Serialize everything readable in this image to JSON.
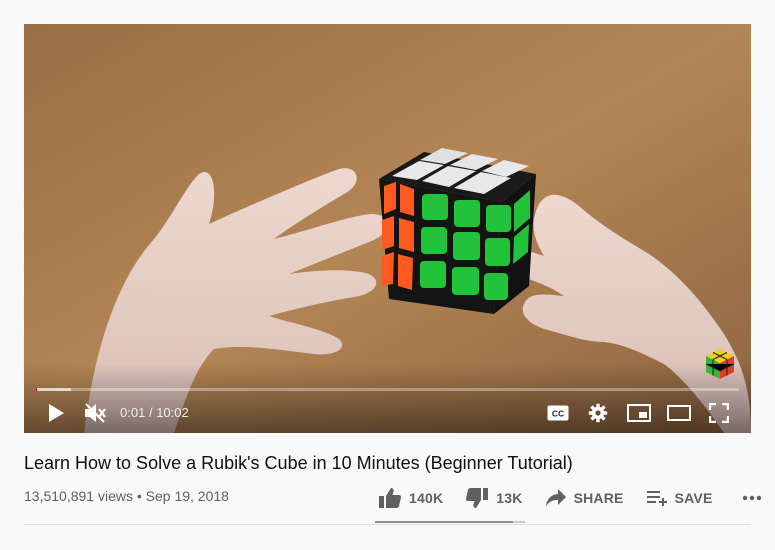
{
  "video": {
    "time_current": "0:01",
    "time_separator": "/",
    "time_total": "10:02",
    "progress_played_fraction": 0.002,
    "progress_loaded_fraction": 0.05
  },
  "controls": {
    "play_icon": "play-icon",
    "mute_icon": "volume-muted-icon",
    "cc_label": "CC",
    "settings_icon": "gear-icon",
    "miniplayer_icon": "miniplayer-icon",
    "theater_icon": "theater-mode-icon",
    "fullscreen_icon": "fullscreen-icon"
  },
  "info": {
    "title": "Learn How to Solve a Rubik's Cube in 10 Minutes (Beginner Tutorial)",
    "views": "13,510,891 views",
    "dot": "•",
    "date": "Sep 19, 2018"
  },
  "actions": {
    "like_count": "140K",
    "dislike_count": "13K",
    "share_label": "SHARE",
    "save_label": "SAVE",
    "more_icon": "more-horizontal-icon",
    "like_ratio": 0.92
  },
  "colors": {
    "accent_red": "#ff0000",
    "table_wood": "#a77b4f",
    "cube_green": "#22c23a",
    "cube_orange": "#ff5a1f"
  }
}
